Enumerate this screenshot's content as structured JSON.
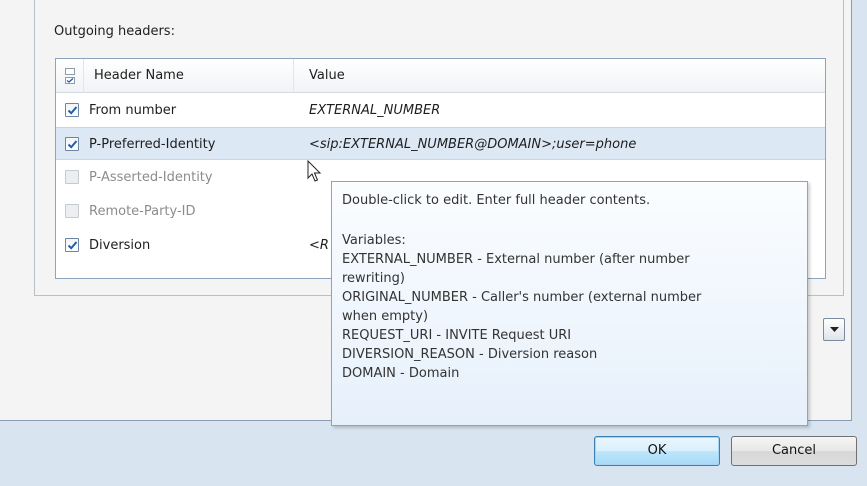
{
  "section": {
    "label": "Outgoing headers:"
  },
  "table": {
    "columns": {
      "name": "Header Name",
      "value": "Value"
    },
    "rows": [
      {
        "checked": true,
        "enabled": true,
        "selected": false,
        "name": "From number",
        "value": "EXTERNAL_NUMBER"
      },
      {
        "checked": true,
        "enabled": true,
        "selected": true,
        "name": "P-Preferred-Identity",
        "value": "<sip:EXTERNAL_NUMBER@DOMAIN>;user=phone"
      },
      {
        "checked": false,
        "enabled": false,
        "selected": false,
        "name": "P-Asserted-Identity",
        "value": ""
      },
      {
        "checked": false,
        "enabled": false,
        "selected": false,
        "name": "Remote-Party-ID",
        "value": ""
      },
      {
        "checked": true,
        "enabled": true,
        "selected": false,
        "name": "Diversion",
        "value": "<R"
      }
    ]
  },
  "tooltip": {
    "line1": "Double-click to edit. Enter full header contents.",
    "line2": "Variables:",
    "line3": "EXTERNAL_NUMBER - External number (after number",
    "line4": "rewriting)",
    "line5": "ORIGINAL_NUMBER - Caller's number (external number",
    "line6": "when empty)",
    "line7": "REQUEST_URI - INVITE Request URI",
    "line8": "DIVERSION_REASON - Diversion reason",
    "line9": "DOMAIN - Domain"
  },
  "buttons": {
    "ok": "OK",
    "cancel": "Cancel"
  },
  "icons": {
    "column_check": "checkbox-column-icon",
    "cursor": "mouse-pointer-icon",
    "dropdown": "chevron-down-icon",
    "check": "checkmark-icon"
  },
  "colors": {
    "checkmark": "#1f5fae",
    "selection": "#dde8f5",
    "tooltip_border": "#8ea3bd"
  }
}
